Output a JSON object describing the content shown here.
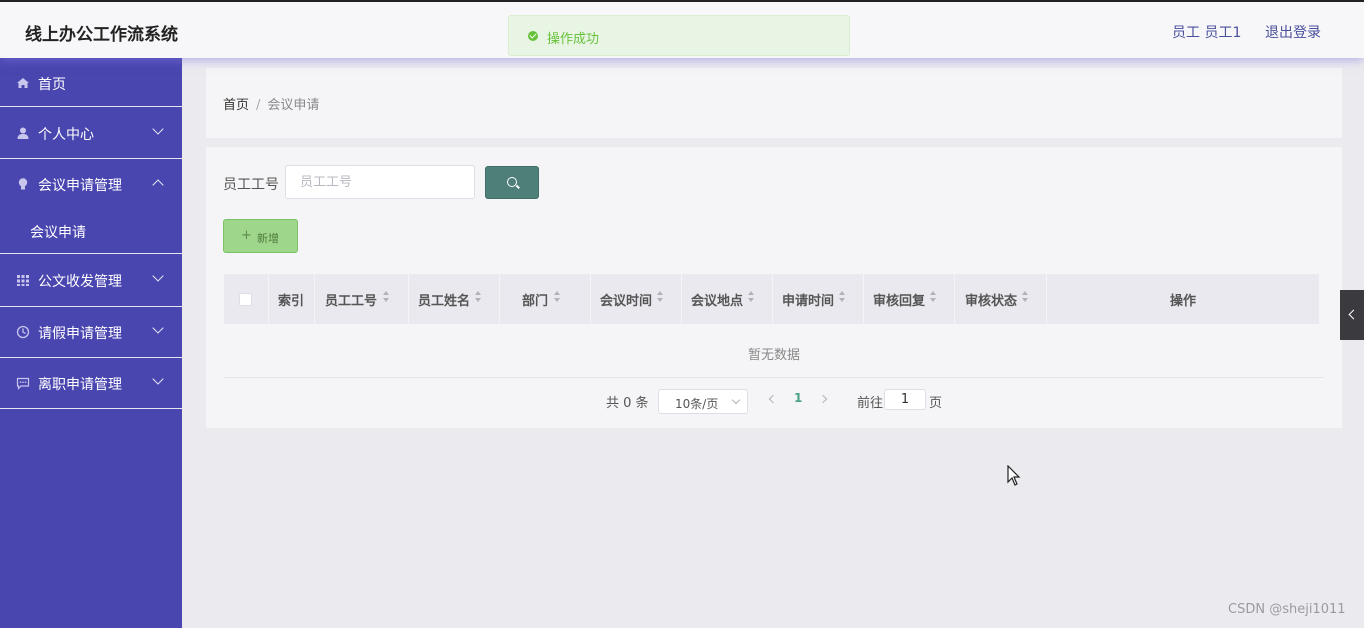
{
  "header": {
    "app_title": "线上办公工作流系统",
    "user_label": "员工 员工1",
    "logout_label": "退出登录"
  },
  "toast": {
    "text": "操作成功",
    "color": "#67c23a"
  },
  "sidebar": {
    "bg_color": "#4a46b0",
    "items": [
      {
        "label": "首页",
        "icon": "home-icon"
      },
      {
        "label": "个人中心",
        "icon": "user-icon"
      },
      {
        "label": "会议申请管理",
        "icon": "bulb-icon",
        "expanded": true
      },
      {
        "label": "会议申请",
        "sub": true
      },
      {
        "label": "公文收发管理",
        "icon": "grid-icon"
      },
      {
        "label": "请假申请管理",
        "icon": "clock-icon"
      },
      {
        "label": "离职申请管理",
        "icon": "chat-icon"
      }
    ]
  },
  "breadcrumb": {
    "home": "首页",
    "separator": "/",
    "current": "会议申请"
  },
  "search": {
    "label": "员工工号",
    "placeholder": "员工工号",
    "value": ""
  },
  "add_button": {
    "label": "新增"
  },
  "table": {
    "columns": [
      "索引",
      "员工工号",
      "员工姓名",
      "部门",
      "会议时间",
      "会议地点",
      "申请时间",
      "审核回复",
      "审核状态",
      "操作"
    ],
    "rows": [],
    "empty_text": "暂无数据"
  },
  "pagination": {
    "total_text": "共 0 条",
    "page_size": "10条/页",
    "current_page": "1",
    "goto_label": "前往",
    "goto_value": "1",
    "page_suffix": "页"
  },
  "watermark": "CSDN @sheji1011"
}
